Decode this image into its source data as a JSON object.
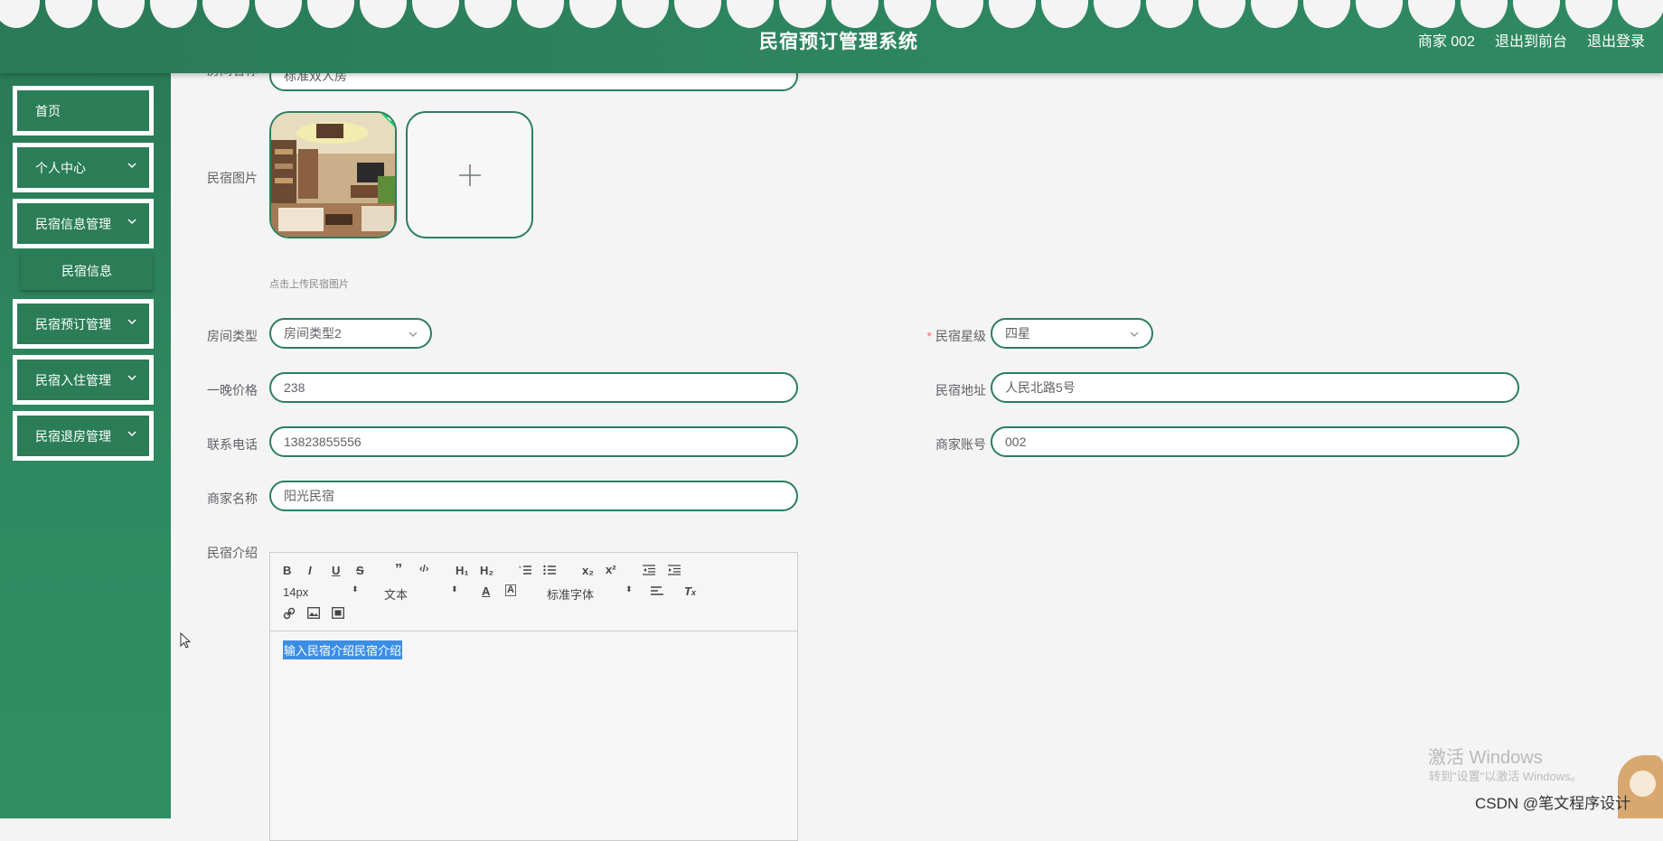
{
  "header": {
    "title": "民宿预订管理系统",
    "user_label": "商家 002",
    "to_front_label": "退出到前台",
    "logout_label": "退出登录"
  },
  "sidebar": {
    "items": [
      {
        "label": "首页",
        "has_arrow": false
      },
      {
        "label": "个人中心",
        "has_arrow": true
      },
      {
        "label": "民宿信息管理",
        "has_arrow": true
      },
      {
        "label": "民宿预订管理",
        "has_arrow": true
      },
      {
        "label": "民宿入住管理",
        "has_arrow": true
      },
      {
        "label": "民宿退房管理",
        "has_arrow": true
      }
    ],
    "subitem": "民宿信息"
  },
  "form": {
    "room_name": {
      "label": "房间名称",
      "value": "标准双人房"
    },
    "image": {
      "label": "民宿图片",
      "tip": "点击上传民宿图片"
    },
    "room_type": {
      "label": "房间类型",
      "value": "房间类型2"
    },
    "star": {
      "label": "民宿星级",
      "value": "四星"
    },
    "price": {
      "label": "一晚价格",
      "value": "238"
    },
    "address": {
      "label": "民宿地址",
      "value": "人民北路5号"
    },
    "phone": {
      "label": "联系电话",
      "value": "13823855556"
    },
    "account": {
      "label": "商家账号",
      "value": "002"
    },
    "merchant_name": {
      "label": "商家名称",
      "value": "阳光民宿"
    },
    "intro": {
      "label": "民宿介绍",
      "font_size": "14px",
      "header_select": "文本",
      "font_family": "标准字体",
      "content": "输入民宿介绍民宿介绍"
    }
  },
  "overlay": {
    "windows_activate": "激活 Windows",
    "windows_activate_sub": "转到\"设置\"以激活 Windows。",
    "csdn": "CSDN @笔文程序设计"
  },
  "colors": {
    "primary": "#2d7e5c",
    "header": "#2a7a57",
    "required": "#f56c6c",
    "selection": "#3b8ee5"
  }
}
